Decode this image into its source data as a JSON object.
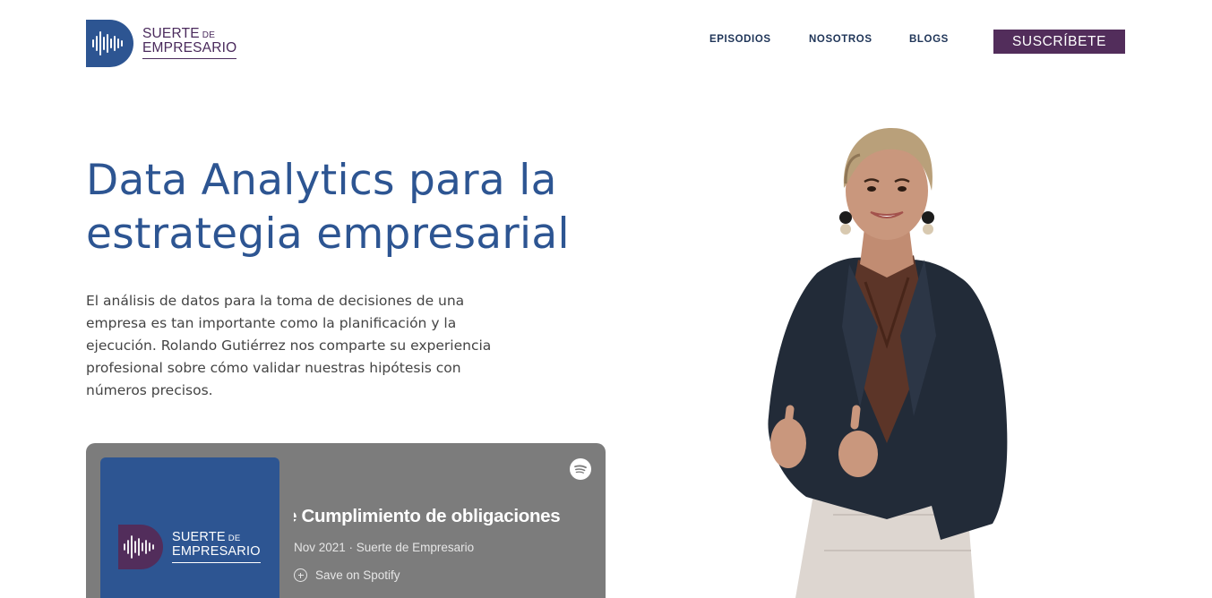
{
  "header": {
    "logo": {
      "line1": "SUERTE",
      "line1_small": "DE",
      "line2": "EMPRESARIO"
    },
    "nav": [
      {
        "label": "EPISODIOS"
      },
      {
        "label": "NOSOTROS"
      },
      {
        "label": "BLOGS"
      }
    ],
    "subscribe_label": "SUSCRÍBETE"
  },
  "hero": {
    "title": "Data Analytics para la estrategia empresarial",
    "description": "El análisis de datos para la toma de decisiones de una empresa es tan importante como la planificación y la ejecución. Rolando Gutiérrez nos comparte su experiencia profesional sobre cómo validar nuestras hipótesis con números precisos."
  },
  "player": {
    "cover_logo": {
      "line1": "SUERTE",
      "line1_small": "DE",
      "line2": "EMPRESARIO"
    },
    "episode_title": "e Cumplimiento de obligaciones",
    "meta": "Nov 2021 · Suerte de Empresario",
    "save_label": "Save on Spotify",
    "icon": "spotify-icon"
  },
  "colors": {
    "brand_blue": "#2d5592",
    "brand_purple": "#522d5b",
    "nav_text": "#1f3558",
    "player_bg": "#7c7c7c"
  }
}
